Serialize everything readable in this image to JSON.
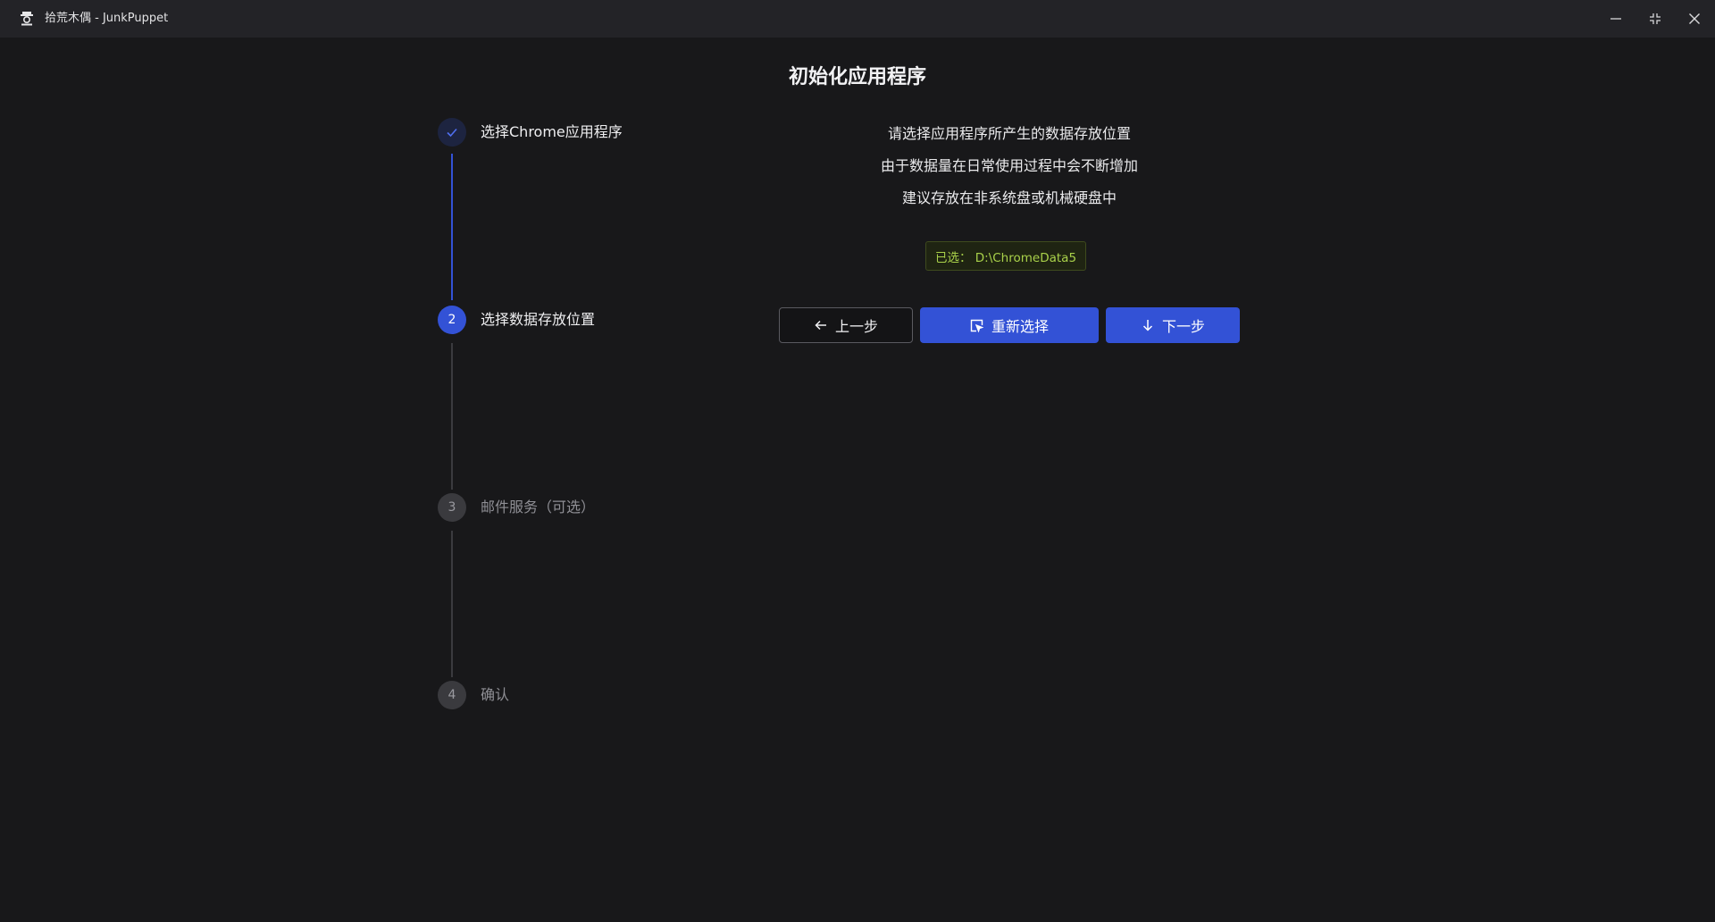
{
  "window": {
    "title": "拾荒木偶 - JunkPuppet",
    "icon": "puppet-logo-icon",
    "controls": [
      "minimize-icon",
      "maximize-icon",
      "close-icon"
    ]
  },
  "page": {
    "title": "初始化应用程序"
  },
  "steps": [
    {
      "number": "",
      "label": "选择Chrome应用程序",
      "state": "done",
      "icon": "check-icon"
    },
    {
      "number": "2",
      "label": "选择数据存放位置",
      "state": "active"
    },
    {
      "number": "3",
      "label": "邮件服务（可选）",
      "state": "pending"
    },
    {
      "number": "4",
      "label": "确认",
      "state": "pending"
    }
  ],
  "content": {
    "lines": [
      "请选择应用程序所产生的数据存放位置",
      "由于数据量在日常使用过程中会不断增加",
      "建议存放在非系统盘或机械硬盘中"
    ],
    "selected_path": "已选： D:\\ChromeData5",
    "buttons": {
      "prev": {
        "label": "上一步",
        "icon": "arrow-left-icon"
      },
      "reselect": {
        "label": "重新选择",
        "icon": "select-cursor-icon"
      },
      "next": {
        "label": "下一步",
        "icon": "arrow-down-icon"
      }
    }
  },
  "colors": {
    "accent": "#3352d6",
    "background": "#18181a",
    "titlebar": "#232327",
    "success_text": "#a9d14a"
  }
}
